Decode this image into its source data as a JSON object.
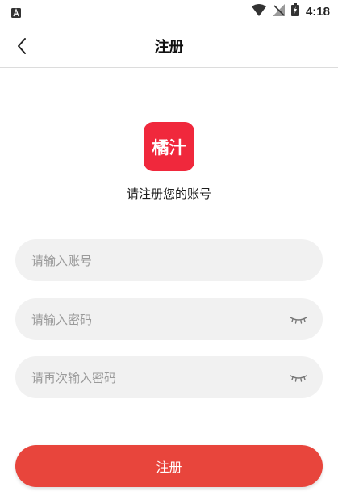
{
  "status_bar": {
    "time": "4:18",
    "icons": [
      "notification-a-icon",
      "wifi-icon",
      "no-signal-icon",
      "battery-charging-icon"
    ]
  },
  "app_bar": {
    "title": "注册",
    "back_icon": "chevron-left-icon"
  },
  "logo": {
    "text": "橘汁",
    "color": "#f0283c"
  },
  "prompt": "请注册您的账号",
  "form": {
    "account_placeholder": "请输入账号",
    "password_placeholder": "请输入密码",
    "confirm_placeholder": "请再次输入密码",
    "password_eye_icon": "eye-closed-icon"
  },
  "submit": {
    "label": "注册",
    "color": "#e8453c"
  }
}
